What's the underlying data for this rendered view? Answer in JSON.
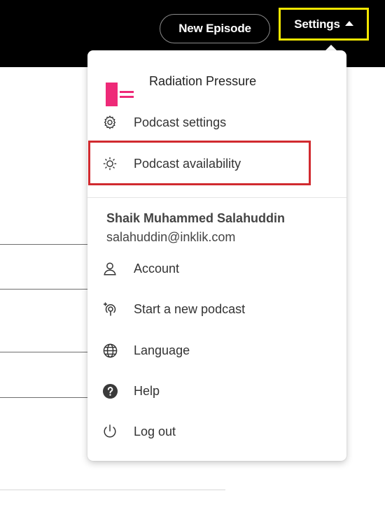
{
  "header": {
    "new_episode_label": "New Episode",
    "settings_label": "Settings"
  },
  "menu": {
    "podcast_name": "Radiation Pressure",
    "podcast_items": [
      {
        "label": "Podcast settings",
        "icon": "gear-icon"
      },
      {
        "label": "Podcast availability",
        "icon": "sun-icon"
      }
    ],
    "user": {
      "name": "Shaik Muhammed Salahuddin",
      "email": "salahuddin@inklik.com"
    },
    "account_items": [
      {
        "label": "Account",
        "icon": "person-icon"
      },
      {
        "label": "Start a new podcast",
        "icon": "new-podcast-icon"
      },
      {
        "label": "Language",
        "icon": "globe-icon"
      },
      {
        "label": "Help",
        "icon": "help-icon"
      },
      {
        "label": "Log out",
        "icon": "power-icon"
      }
    ]
  },
  "colors": {
    "header_bg": "#000000",
    "settings_highlight": "#f2e600",
    "availability_highlight": "#d12a2f",
    "logo_pink": "#ee2a78"
  }
}
